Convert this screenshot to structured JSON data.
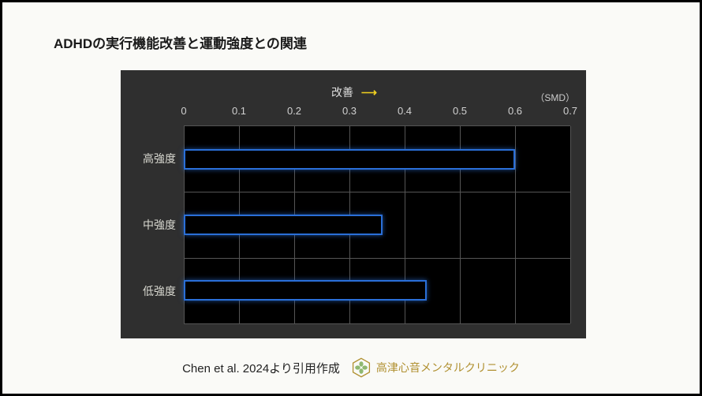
{
  "title": "ADHDの実行機能改善と運動強度との関連",
  "improve_label": "改善",
  "unit_label": "（SMD）",
  "chart_data": {
    "type": "bar",
    "orientation": "horizontal",
    "categories": [
      "高強度",
      "中強度",
      "低強度"
    ],
    "values": [
      0.6,
      0.36,
      0.44
    ],
    "xlabel": "",
    "ylabel": "",
    "xlim": [
      0,
      0.7
    ],
    "ticks": [
      0,
      0.1,
      0.2,
      0.3,
      0.4,
      0.5,
      0.6,
      0.7
    ],
    "tick_labels": [
      "0",
      "0.1",
      "0.2",
      "0.3",
      "0.4",
      "0.5",
      "0.6",
      "0.7"
    ],
    "title": "ADHDの実行機能改善と運動強度との関連",
    "annotation": "改善 →",
    "unit": "SMD",
    "bar_stroke": "#2a6fd8",
    "bg": "#000000"
  },
  "source_text": "Chen et al. 2024より引用作成",
  "clinic_name": "高津心音メンタルクリニック"
}
